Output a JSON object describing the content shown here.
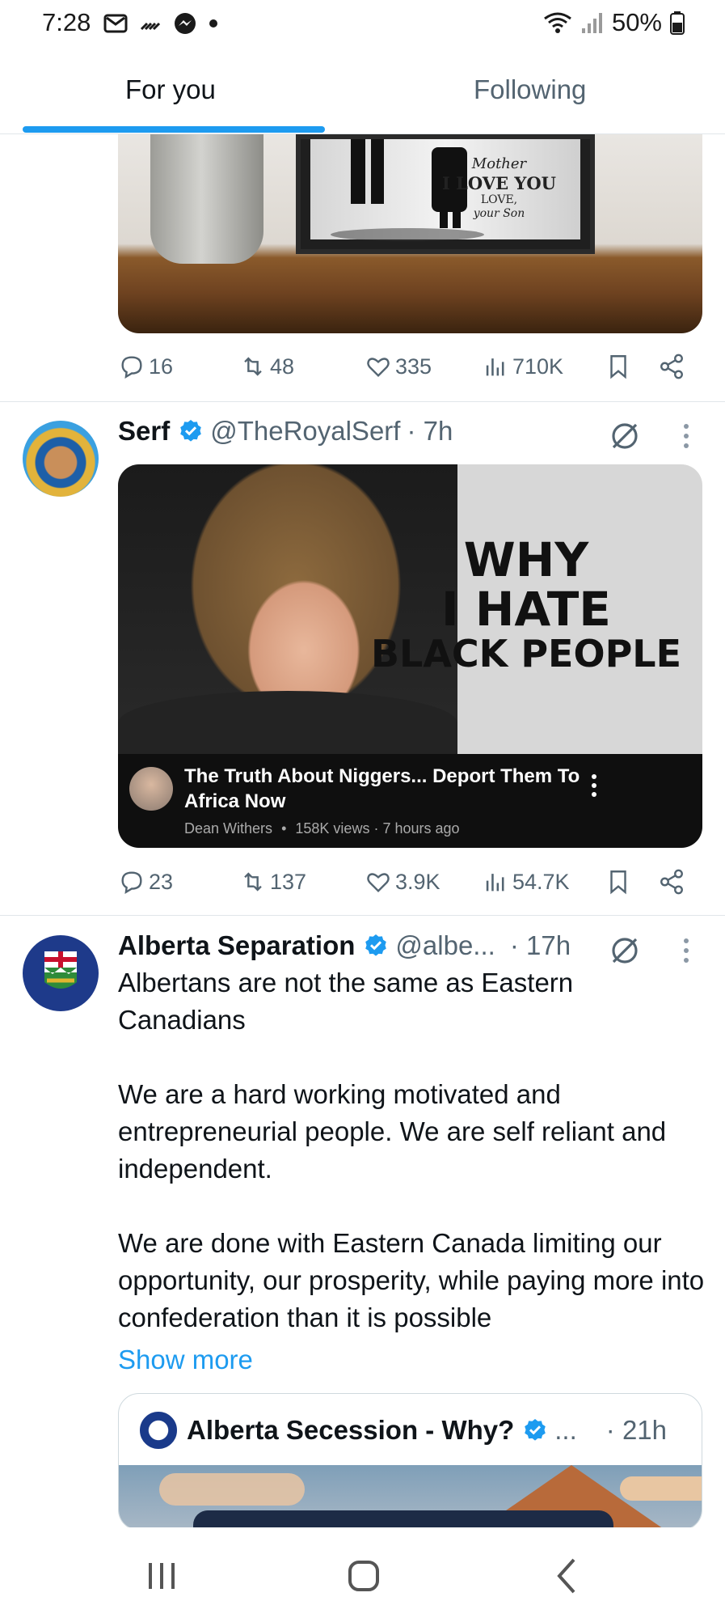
{
  "status_bar": {
    "time": "7:28",
    "battery": "50%",
    "left_icons": [
      "mail-icon",
      "missed-call-icon",
      "messenger-icon",
      "dot-icon"
    ],
    "right_icons": [
      "wifi-icon",
      "signal-icon",
      "battery-icon"
    ]
  },
  "tabs": {
    "for_you": "For you",
    "following": "Following",
    "active": "for_you"
  },
  "colors": {
    "accent": "#1d9bf0",
    "text_primary": "#0f1419",
    "text_secondary": "#536471",
    "divider": "#e1e6ea"
  },
  "tweets": [
    {
      "media_text": {
        "line1": "Mother",
        "line2": "I LOVE YOU",
        "line3": "LOVE,",
        "line4": "your Son"
      },
      "stats": {
        "replies": "16",
        "reposts": "48",
        "likes": "335",
        "views": "710K"
      }
    },
    {
      "name": "Serf",
      "handle": "@TheRoyalSerf",
      "time": "· 7h",
      "verified": true,
      "media": {
        "headline_1": "WHY",
        "headline_2": "I HATE",
        "headline_3": "BLACK PEOPLE",
        "video_title": "The Truth About Niggers... Deport Them To Africa Now",
        "channel": "Dean Withers",
        "views": "158K views",
        "age": "7 hours ago",
        "separator": "•"
      },
      "stats": {
        "replies": "23",
        "reposts": "137",
        "likes": "3.9K",
        "views": "54.7K"
      }
    },
    {
      "name": "Alberta Separation",
      "handle": "@albe...",
      "time": "· 17h",
      "verified": true,
      "body": [
        "Albertans are not the same as Eastern Canadians",
        "We are a hard working motivated and entrepreneurial people.  We are self reliant and independent.",
        "We are done with Eastern Canada limiting our opportunity, our prosperity, while paying more into confederation than it is possible"
      ],
      "show_more": "Show more",
      "quote": {
        "name": "Alberta Secession - Why?",
        "handle": "...",
        "time": "· 21h",
        "verified": true
      }
    }
  ],
  "nav": {
    "icons": [
      "recents-icon",
      "home-icon",
      "back-icon"
    ]
  }
}
